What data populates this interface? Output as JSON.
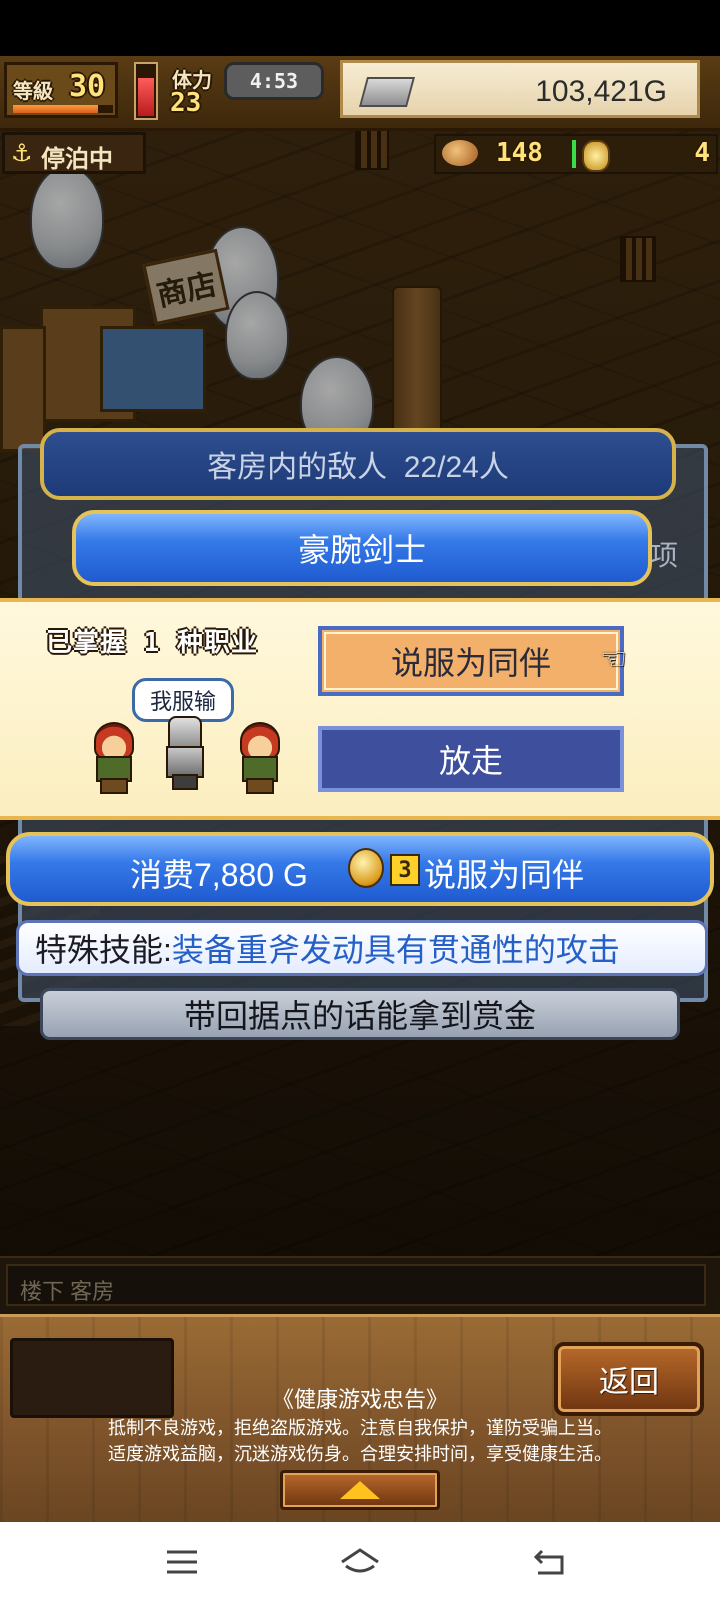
{
  "hud": {
    "level_label": "等級",
    "level_value": "30",
    "level_exp_fraction": 0.85,
    "stamina_label": "体力",
    "stamina_value": "23",
    "stamina_fraction": 0.75,
    "clock": "4:53",
    "money": "103,421G",
    "money_icon": "silver-bar-icon"
  },
  "status_row": {
    "anchor_icon": "anchor-icon",
    "anchor_text": "停泊中",
    "food_icon": "food-icon",
    "food_value": "148",
    "coin_icon": "coin-icon",
    "coin_value": "4"
  },
  "scene": {
    "shop_sign": "商店"
  },
  "room_panel": {
    "header": "客房内的敌人  22/24人",
    "class_banner": "豪腕剑士",
    "leftover_text": "项"
  },
  "dialog": {
    "mastered": "已掌握 1 种职业",
    "speech": "我服输",
    "persuade_label": "说服为同伴",
    "release_label": "放走",
    "pointer_icon": "pointing-hand-icon"
  },
  "cost": {
    "text": "消费7,880 G",
    "coin_icon": "medal-coin-icon",
    "badge": "3",
    "after": "说服为同伴"
  },
  "skill": {
    "label": "特殊技能:",
    "desc": "装备重斧发动具有贯通性的攻击"
  },
  "bounty": "带回据点的话能拿到赏金",
  "location": "楼下 客房",
  "bottom": {
    "back_label": "返回",
    "notice_title": "《健康游戏忠告》",
    "notice_line1": "抵制不良游戏，拒绝盗版游戏。注意自我保护，谨防受骗上当。",
    "notice_line2": "适度游戏益脑，沉迷游戏伤身。合理安排时间，享受健康生活。",
    "expand_icon": "triangle-up-icon"
  },
  "navbar": {
    "menu_icon": "menu-icon",
    "home_icon": "home-icon",
    "back_icon": "back-icon"
  },
  "colors": {
    "accent_gold": "#e6c35a",
    "banner_blue": "#3579e8",
    "dialog_cream": "#fff8dc",
    "persuade_orange": "#f2b06a",
    "release_blue": "#3e4f9e",
    "skill_blue": "#2560c8"
  }
}
